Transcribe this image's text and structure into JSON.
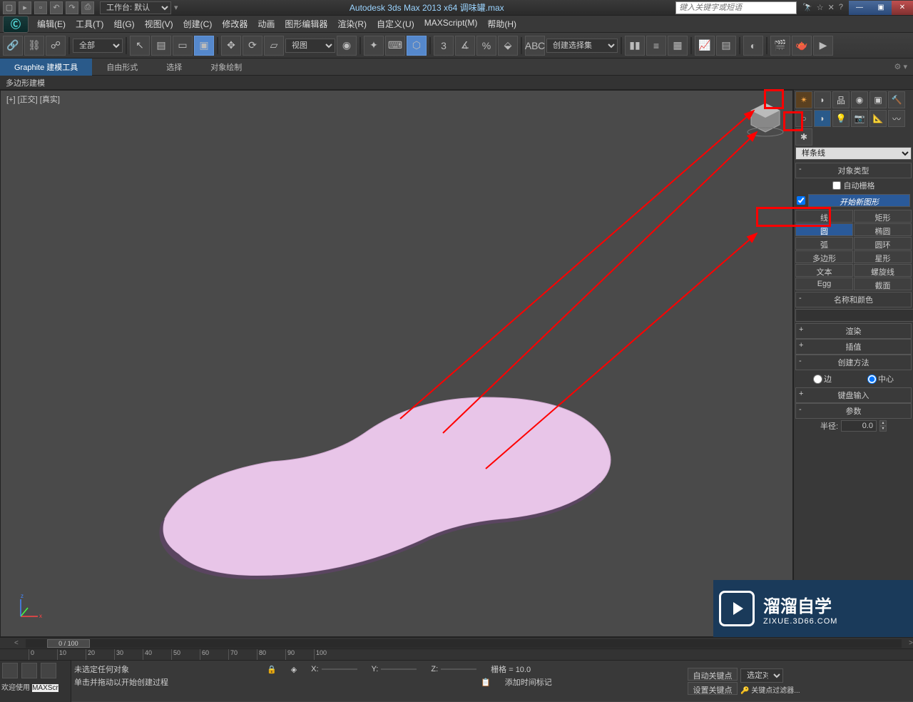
{
  "titleBar": {
    "workspaceLabel": "工作台: 默认",
    "appTitle": "Autodesk 3ds Max  2013 x64      调味罐.max",
    "searchPlaceholder": "键入关键字或短语"
  },
  "menu": {
    "items": [
      "编辑(E)",
      "工具(T)",
      "组(G)",
      "视图(V)",
      "创建(C)",
      "修改器",
      "动画",
      "图形编辑器",
      "渲染(R)",
      "自定义(U)",
      "MAXScript(M)",
      "帮助(H)"
    ]
  },
  "mainToolbar": {
    "filterAll": "全部",
    "viewDropdown": "视图",
    "selectionSet": "创建选择集"
  },
  "ribbon": {
    "tabs": [
      "Graphite 建模工具",
      "自由形式",
      "选择",
      "对象绘制"
    ],
    "sub": "多边形建模"
  },
  "viewport": {
    "label": "[+] [正交] [真实]"
  },
  "panel": {
    "splineDropdown": "样条线",
    "rollouts": {
      "objectType": "对象类型",
      "autoGrid": "自动栅格",
      "startNewShape": "开始新图形",
      "nameColor": "名称和颜色",
      "render": "渲染",
      "interpolation": "插值",
      "createMethod": "创建方法",
      "keyboardEntry": "键盘输入",
      "params": "参数"
    },
    "shapes": {
      "line": "线",
      "rectangle": "矩形",
      "circle": "圆",
      "ellipse": "椭圆",
      "arc": "弧",
      "donut": "圆环",
      "ngon": "多边形",
      "star": "星形",
      "text": "文本",
      "helix": "螺旋线",
      "egg": "Egg",
      "section": "截面"
    },
    "createMethodOptions": {
      "edge": "边",
      "center": "中心"
    },
    "radiusLabel": "半径:",
    "radiusValue": "0.0"
  },
  "timeline": {
    "slider": "0 / 100",
    "ticks": [
      0,
      10,
      20,
      30,
      40,
      50,
      60,
      70,
      80,
      90,
      100
    ]
  },
  "statusBar": {
    "welcome": "欢迎使用",
    "maxscr": "MAXScr",
    "noSelection": "未选定任何对象",
    "prompt": "单击并拖动以开始创建过程",
    "coords": {
      "x": "X:",
      "y": "Y:",
      "z": "Z:"
    },
    "grid": "栅格 = 10.0",
    "addTimeTag": "添加时间标记",
    "autoKey": "自动关键点",
    "selected": "选定对",
    "setKey": "设置关键点",
    "keyFilter": "关键点过滤器..."
  },
  "watermark": {
    "cn": "溜溜自学",
    "en": "ZIXUE.3D66.COM"
  }
}
